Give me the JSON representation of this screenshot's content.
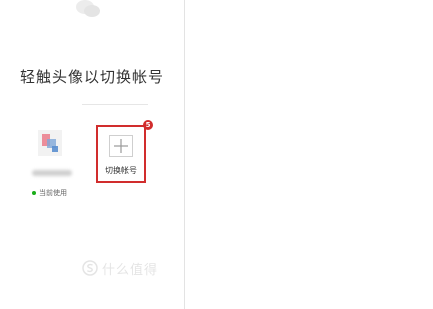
{
  "title": "轻触头像以切换帐号",
  "account": {
    "status_text": "当前使用",
    "status_color": "#1aad19"
  },
  "switch_account": {
    "label": "切换帐号",
    "icon": "plus-icon"
  },
  "annotation": {
    "step_number": "5",
    "highlight_color": "#d12d2d"
  },
  "logo": {
    "icon": "wechat-logo-icon"
  },
  "watermark": {
    "icon": "watermark-s-icon",
    "text": "什么值得"
  }
}
